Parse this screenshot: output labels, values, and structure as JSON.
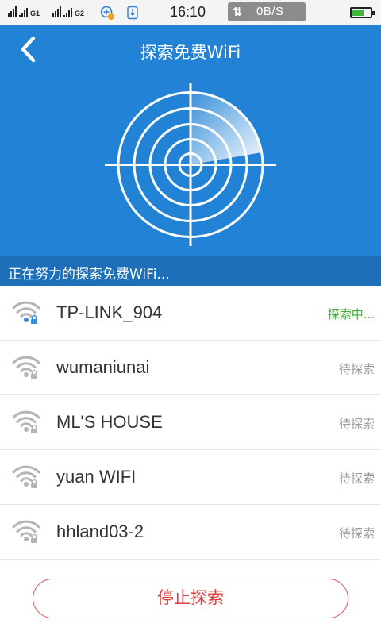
{
  "status_bar": {
    "sim1_label": "G1",
    "sim2_label": "G2",
    "time": "16:10",
    "net_speed": "0B/S"
  },
  "header": {
    "title": "探索免费WiFi",
    "status_text": "正在努力的探索免费WiFi..."
  },
  "colors": {
    "header_bg": "#2283d6",
    "status_strip_bg": "#1c6fb8",
    "active_state": "#3fae37",
    "idle_state": "#9a9a9a",
    "stop_button": "#e03c3c",
    "wifi_icon_active": "#2f8de0",
    "wifi_icon_idle": "#b5b5b5"
  },
  "networks": [
    {
      "ssid": "TP-LINK_904",
      "state": "探索中...",
      "active": true
    },
    {
      "ssid": "wumaniunai",
      "state": "待探索",
      "active": false
    },
    {
      "ssid": "ML'S HOUSE",
      "state": "待探索",
      "active": false
    },
    {
      "ssid": "yuan WIFI",
      "state": "待探索",
      "active": false
    },
    {
      "ssid": "hhland03-2",
      "state": "待探索",
      "active": false
    }
  ],
  "icons": {
    "back": "chevron-left-icon",
    "radar": "radar-icon",
    "wifi": "wifi-locked-icon"
  },
  "stop_button_label": "停止探索"
}
